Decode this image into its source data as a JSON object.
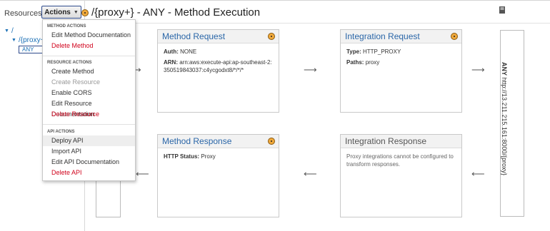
{
  "sidebar": {
    "label": "Resources",
    "actions_label": "Actions",
    "tree": {
      "root": "/",
      "child": "/{proxy+}",
      "method": "ANY"
    }
  },
  "header": {
    "title": "/{proxy+} - ANY - Method Execution"
  },
  "menu": {
    "method_header": "METHOD ACTIONS",
    "edit_method_doc": "Edit Method Documentation",
    "delete_method": "Delete Method",
    "resource_header": "RESOURCE ACTIONS",
    "create_method": "Create Method",
    "create_resource": "Create Resource",
    "enable_cors": "Enable CORS",
    "edit_resource_doc": "Edit Resource Documentation",
    "delete_resource": "Delete Resource",
    "api_header": "API ACTIONS",
    "deploy_api": "Deploy API",
    "import_api": "Import API",
    "edit_api_doc": "Edit API Documentation",
    "delete_api": "Delete API"
  },
  "method_request": {
    "title": "Method Request",
    "auth_label": "Auth:",
    "auth_value": "NONE",
    "arn_label": "ARN:",
    "arn_value": "arn:aws:execute-api:ap-southeast-2:350519843037:c4ycgodxt8/*/*/*"
  },
  "integration_request": {
    "title": "Integration Request",
    "type_label": "Type:",
    "type_value": "HTTP_PROXY",
    "paths_label": "Paths:",
    "paths_value": "proxy"
  },
  "method_response": {
    "title": "Method Response",
    "status_label": "HTTP Status:",
    "status_value": "Proxy"
  },
  "integration_response": {
    "title": "Integration Response",
    "note": "Proxy integrations cannot be configured to transform responses."
  },
  "endpoint": {
    "method": "ANY",
    "url": "http://13.211.215.161:8000/{proxy}"
  },
  "colors": {
    "accent": "#2a66a8",
    "danger": "#d0021b",
    "badge": "#f0a93b"
  }
}
